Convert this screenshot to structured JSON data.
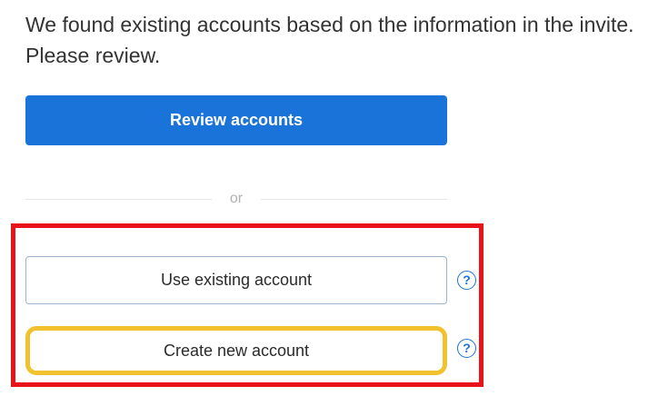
{
  "message": "We found existing accounts based on the information in the invite. Please review.",
  "review_button": {
    "label": "Review accounts",
    "color": "#1a73d9"
  },
  "divider": {
    "label": "or"
  },
  "options": {
    "use_existing": {
      "label": "Use existing account",
      "help_icon": "question-circle-icon",
      "help_glyph": "?"
    },
    "create_new": {
      "label": "Create new account",
      "help_icon": "question-circle-icon",
      "help_glyph": "?"
    }
  },
  "annotations": {
    "highlight_frame_color": "#e8141c",
    "highlight_button_color": "#f2c12e"
  }
}
